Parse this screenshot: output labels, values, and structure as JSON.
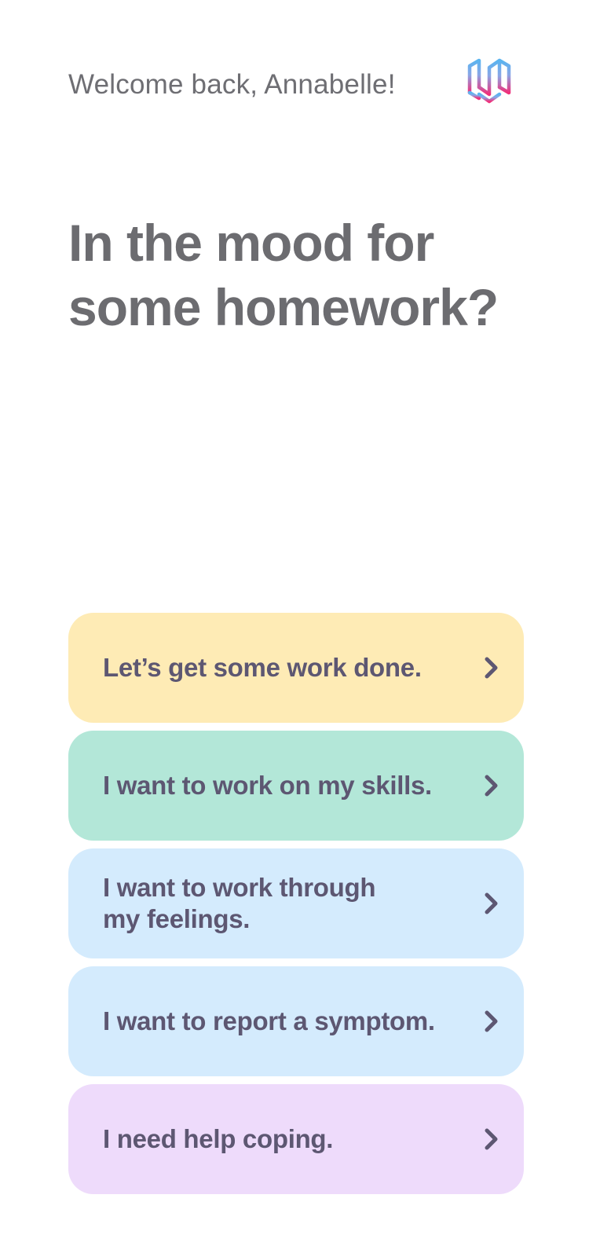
{
  "header": {
    "greeting": "Welcome back, Annabelle!"
  },
  "headline": {
    "line1": "In the mood for",
    "line2": "some homework?"
  },
  "options": [
    {
      "label": "Let’s get some work done.",
      "color": "#feebb5"
    },
    {
      "label": "I want to work on my skills.",
      "color": "#b3e7d8"
    },
    {
      "label": "I want to work through my feelings.",
      "color": "#d4ebfd"
    },
    {
      "label": "I want to report a symptom.",
      "color": "#d4ebfd"
    },
    {
      "label": "I need help coping.",
      "color": "#eedbfb"
    }
  ],
  "icons": {
    "logo": "brand-logo-icon",
    "chevron": "chevron-right-icon"
  },
  "colors": {
    "text_primary": "#6c6c70",
    "option_text": "#5d5772",
    "logo_gradient_top": "#5ab4f0",
    "logo_gradient_bottom": "#f0307a"
  }
}
